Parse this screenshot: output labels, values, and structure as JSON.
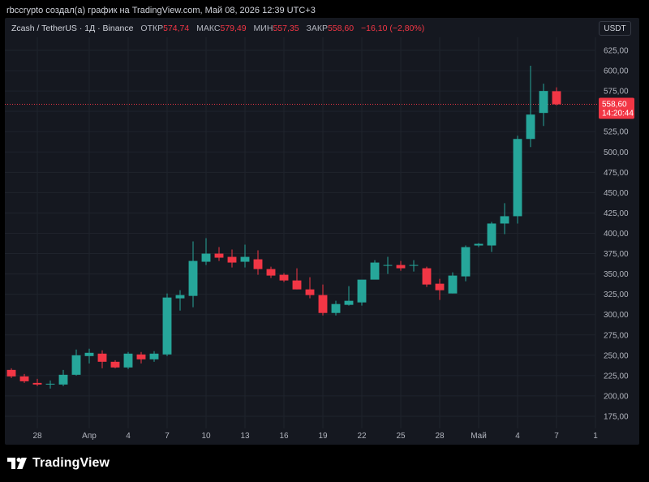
{
  "caption": "rbccrypto создал(а) график на TradingView.com, Май 08, 2026 12:39 UTC+3",
  "legend": {
    "symbol": "Zcash / TetherUS · 1Д · Binance",
    "open_label": "ОТКР",
    "open_value": "574,74",
    "high_label": "МАКС",
    "high_value": "579,49",
    "low_label": "МИН",
    "low_value": "557,35",
    "close_label": "ЗАКР",
    "close_value": "558,60",
    "change": "−16,10 (−2,80%)"
  },
  "currency": "USDT",
  "price_tag": {
    "price": "558,60",
    "countdown": "14:20:44"
  },
  "branding": {
    "logo_text": "TradingView"
  },
  "colors": {
    "up": "#26a69a",
    "down": "#f23645",
    "background": "#151820",
    "grid": "#1f232c",
    "axis_text": "#b2b5be"
  },
  "chart_data": {
    "type": "candlestick",
    "title": "Zcash / TetherUS · 1Д · Binance",
    "y_axis": {
      "position": "right",
      "range": [
        160,
        635
      ],
      "ticks": [
        175,
        200,
        225,
        250,
        275,
        300,
        325,
        350,
        375,
        400,
        425,
        450,
        475,
        500,
        525,
        550,
        575,
        600,
        625
      ],
      "tick_labels": [
        "175,00",
        "200,00",
        "225,00",
        "250,00",
        "275,00",
        "300,00",
        "325,00",
        "350,00",
        "375,00",
        "400,00",
        "425,00",
        "450,00",
        "475,00",
        "500,00",
        "525,00",
        "550,00",
        "575,00",
        "600,00",
        "625,00"
      ]
    },
    "x_axis": {
      "index_range": [
        -0.5,
        45
      ],
      "ticks": [
        {
          "index": 2,
          "label": "28"
        },
        {
          "index": 6,
          "label": "Апр"
        },
        {
          "index": 9,
          "label": "4"
        },
        {
          "index": 12,
          "label": "7"
        },
        {
          "index": 15,
          "label": "10"
        },
        {
          "index": 18,
          "label": "13"
        },
        {
          "index": 21,
          "label": "16"
        },
        {
          "index": 24,
          "label": "19"
        },
        {
          "index": 27,
          "label": "22"
        },
        {
          "index": 30,
          "label": "25"
        },
        {
          "index": 33,
          "label": "28"
        },
        {
          "index": 36,
          "label": "Май"
        },
        {
          "index": 39,
          "label": "4"
        },
        {
          "index": 42,
          "label": "7"
        },
        {
          "index": 45,
          "label": "1"
        }
      ]
    },
    "last_price": 558.6,
    "grid": true,
    "candles": [
      {
        "o": 232,
        "h": 234,
        "l": 222,
        "c": 224
      },
      {
        "o": 224,
        "h": 227,
        "l": 216,
        "c": 218
      },
      {
        "o": 216,
        "h": 221,
        "l": 212,
        "c": 214
      },
      {
        "o": 214,
        "h": 219,
        "l": 209,
        "c": 215
      },
      {
        "o": 214,
        "h": 232,
        "l": 212,
        "c": 226
      },
      {
        "o": 226,
        "h": 257,
        "l": 225,
        "c": 250
      },
      {
        "o": 249,
        "h": 258,
        "l": 240,
        "c": 253
      },
      {
        "o": 252,
        "h": 256,
        "l": 234,
        "c": 242
      },
      {
        "o": 242,
        "h": 244,
        "l": 234,
        "c": 235
      },
      {
        "o": 235,
        "h": 254,
        "l": 233,
        "c": 252
      },
      {
        "o": 251,
        "h": 254,
        "l": 240,
        "c": 245
      },
      {
        "o": 245,
        "h": 255,
        "l": 242,
        "c": 252
      },
      {
        "o": 251,
        "h": 326,
        "l": 249,
        "c": 321
      },
      {
        "o": 320,
        "h": 330,
        "l": 305,
        "c": 324
      },
      {
        "o": 323,
        "h": 390,
        "l": 309,
        "c": 366
      },
      {
        "o": 365,
        "h": 394,
        "l": 361,
        "c": 375
      },
      {
        "o": 375,
        "h": 383,
        "l": 366,
        "c": 370
      },
      {
        "o": 371,
        "h": 380,
        "l": 358,
        "c": 364
      },
      {
        "o": 365,
        "h": 386,
        "l": 358,
        "c": 371
      },
      {
        "o": 368,
        "h": 379,
        "l": 349,
        "c": 356
      },
      {
        "o": 356,
        "h": 359,
        "l": 345,
        "c": 348
      },
      {
        "o": 349,
        "h": 351,
        "l": 340,
        "c": 342
      },
      {
        "o": 342,
        "h": 357,
        "l": 331,
        "c": 331
      },
      {
        "o": 331,
        "h": 346,
        "l": 320,
        "c": 324
      },
      {
        "o": 324,
        "h": 337,
        "l": 299,
        "c": 302
      },
      {
        "o": 302,
        "h": 317,
        "l": 299,
        "c": 313
      },
      {
        "o": 312,
        "h": 335,
        "l": 311,
        "c": 317
      },
      {
        "o": 315,
        "h": 337,
        "l": 311,
        "c": 343
      },
      {
        "o": 343,
        "h": 367,
        "l": 344,
        "c": 364
      },
      {
        "o": 361,
        "h": 371,
        "l": 350,
        "c": 361
      },
      {
        "o": 361,
        "h": 366,
        "l": 354,
        "c": 357
      },
      {
        "o": 360,
        "h": 367,
        "l": 353,
        "c": 361
      },
      {
        "o": 357,
        "h": 359,
        "l": 334,
        "c": 337
      },
      {
        "o": 338,
        "h": 344,
        "l": 318,
        "c": 330
      },
      {
        "o": 326,
        "h": 352,
        "l": 326,
        "c": 348
      },
      {
        "o": 347,
        "h": 385,
        "l": 341,
        "c": 383
      },
      {
        "o": 385,
        "h": 388,
        "l": 383,
        "c": 387
      },
      {
        "o": 385,
        "h": 414,
        "l": 377,
        "c": 412
      },
      {
        "o": 412,
        "h": 437,
        "l": 399,
        "c": 421
      },
      {
        "o": 421,
        "h": 520,
        "l": 412,
        "c": 516
      },
      {
        "o": 516,
        "h": 606,
        "l": 506,
        "c": 546
      },
      {
        "o": 548,
        "h": 584,
        "l": 532,
        "c": 575
      },
      {
        "o": 574.74,
        "h": 579.49,
        "l": 557.35,
        "c": 558.6
      }
    ]
  }
}
